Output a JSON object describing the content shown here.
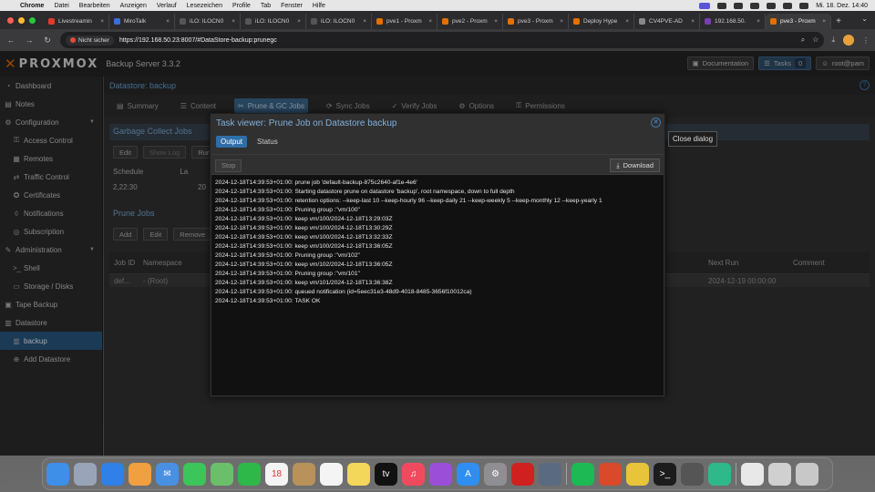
{
  "menubar": {
    "app": "Chrome",
    "items": [
      "Datei",
      "Bearbeiten",
      "Anzeigen",
      "Verlauf",
      "Lesezeichen",
      "Profile",
      "Tab",
      "Fenster",
      "Hilfe"
    ],
    "clock": "Mi. 18. Dez.  14:40"
  },
  "browser": {
    "tabs": [
      {
        "label": "Livestreamin",
        "color": "#e03b2b"
      },
      {
        "label": "MiroTalk",
        "color": "#3a6ee0"
      },
      {
        "label": "iLO: ILOCN0",
        "color": "#555555"
      },
      {
        "label": "iLO: ILOCN0",
        "color": "#555555"
      },
      {
        "label": "iLO: ILOCN0",
        "color": "#555555"
      },
      {
        "label": "pve1 - Proxm",
        "color": "#e57000"
      },
      {
        "label": "pve2 - Proxm",
        "color": "#e57000"
      },
      {
        "label": "pve3 - Proxm",
        "color": "#e57000"
      },
      {
        "label": "Deploy Hype",
        "color": "#e57000"
      },
      {
        "label": "CV4PVE-AD",
        "color": "#888888"
      },
      {
        "label": "192.168.50.",
        "color": "#7a3fb0"
      },
      {
        "label": "pve3 - Proxm",
        "color": "#e57000"
      }
    ],
    "insecure_label": "Nicht sicher",
    "url": "https://192.168.50.23:8007/#DataStore-backup:prunegc"
  },
  "header": {
    "logo": "PROXMOX",
    "product": "Backup Server 3.3.2",
    "documentation": "Documentation",
    "tasks": "Tasks",
    "tasks_count": "0",
    "user": "root@pam"
  },
  "sidebar": {
    "items": [
      {
        "label": "Dashboard",
        "icon": "dashboard-icon",
        "glyph": "◔",
        "level": 0
      },
      {
        "label": "Notes",
        "icon": "notes-icon",
        "glyph": "▤",
        "level": 0
      },
      {
        "label": "Configuration",
        "icon": "gear-icon",
        "glyph": "⚙",
        "level": 0,
        "expanded": true
      },
      {
        "label": "Access Control",
        "icon": "key-icon",
        "glyph": "⚿",
        "level": 1
      },
      {
        "label": "Remotes",
        "icon": "server-icon",
        "glyph": "▦",
        "level": 1
      },
      {
        "label": "Traffic Control",
        "icon": "traffic-icon",
        "glyph": "⇄",
        "level": 1
      },
      {
        "label": "Certificates",
        "icon": "certificate-icon",
        "glyph": "✪",
        "level": 1
      },
      {
        "label": "Notifications",
        "icon": "bell-icon",
        "glyph": "◊",
        "level": 1
      },
      {
        "label": "Subscription",
        "icon": "support-icon",
        "glyph": "◎",
        "level": 1
      },
      {
        "label": "Administration",
        "icon": "wrench-icon",
        "glyph": "✎",
        "level": 0,
        "expanded": true
      },
      {
        "label": "Shell",
        "icon": "terminal-icon",
        "glyph": ">_",
        "level": 1
      },
      {
        "label": "Storage / Disks",
        "icon": "disk-icon",
        "glyph": "▭",
        "level": 1
      },
      {
        "label": "Tape Backup",
        "icon": "tape-icon",
        "glyph": "▣",
        "level": 0
      },
      {
        "label": "Datastore",
        "icon": "database-icon",
        "glyph": "▥",
        "level": 0
      },
      {
        "label": "backup",
        "icon": "datastore-icon",
        "glyph": "▥",
        "level": 1,
        "selected": true
      },
      {
        "label": "Add Datastore",
        "icon": "plus-circle-icon",
        "glyph": "⊕",
        "level": 1
      }
    ]
  },
  "main": {
    "breadcrumb": "Datastore: backup",
    "tabs": [
      {
        "label": "Summary",
        "glyph": "▤"
      },
      {
        "label": "Content",
        "glyph": "☰"
      },
      {
        "label": "Prune & GC Jobs",
        "glyph": "✂",
        "active": true
      },
      {
        "label": "Sync Jobs",
        "glyph": "⟳"
      },
      {
        "label": "Verify Jobs",
        "glyph": "✓"
      },
      {
        "label": "Options",
        "glyph": "⚙"
      },
      {
        "label": "Permissions",
        "glyph": "⚿"
      }
    ],
    "gc": {
      "title": "Garbage Collect Jobs",
      "edit": "Edit",
      "show_log": "Show Log",
      "run": "Run",
      "col_schedule": "Schedule",
      "col_last": "La",
      "schedule_value": "2,22:30",
      "last_value": "20"
    },
    "prune": {
      "title": "Prune Jobs",
      "add": "Add",
      "edit": "Edit",
      "remove": "Remove",
      "col_job_id": "Job ID",
      "col_namespace": "Namespace",
      "col_next_run": "Next Run",
      "col_comment": "Comment",
      "row_job_id": "def...",
      "row_namespace": "- (Root)",
      "row_next_run": "2024-12-19 00:00:00"
    }
  },
  "dialog": {
    "title": "Task viewer: Prune Job on Datastore backup",
    "tab_output": "Output",
    "tab_status": "Status",
    "stop": "Stop",
    "download": "Download",
    "close_tooltip": "Close dialog",
    "log": [
      "2024-12-18T14:39:53+01:00: prune job 'default-backup-875c2640-af1e-4e6'",
      "2024-12-18T14:39:53+01:00: Starting datastore prune on datastore 'backup', root namespace, down to full depth",
      "2024-12-18T14:39:53+01:00: retention options: --keep-last 10 --keep-hourly 96 --keep-daily 21 --keep-weekly 5 --keep-monthly 12 --keep-yearly 1",
      "2024-12-18T14:39:53+01:00: Pruning group :\"vm/100\"",
      "2024-12-18T14:39:53+01:00: keep vm/100/2024-12-18T13:29:03Z",
      "2024-12-18T14:39:53+01:00: keep vm/100/2024-12-18T13:30:29Z",
      "2024-12-18T14:39:53+01:00: keep vm/100/2024-12-18T13:32:33Z",
      "2024-12-18T14:39:53+01:00: keep vm/100/2024-12-18T13:36:05Z",
      "2024-12-18T14:39:53+01:00: Pruning group :\"vm/102\"",
      "2024-12-18T14:39:53+01:00: keep vm/102/2024-12-18T13:36:05Z",
      "2024-12-18T14:39:53+01:00: Pruning group :\"vm/101\"",
      "2024-12-18T14:39:53+01:00: keep vm/101/2024-12-18T13:36:38Z",
      "2024-12-18T14:39:53+01:00: queued notification (id=5eec31e3-48d9-4018-8485-3656f10012ca)",
      "2024-12-18T14:39:53+01:00: TASK OK"
    ]
  },
  "dock": {
    "apps": [
      {
        "name": "finder-icon",
        "color": "#3d8fe8",
        "glyph": ""
      },
      {
        "name": "launchpad-icon",
        "color": "#9aa4b8",
        "glyph": ""
      },
      {
        "name": "safari-icon",
        "color": "#2f80e8",
        "glyph": ""
      },
      {
        "name": "photos-icon",
        "color": "#f0a040",
        "glyph": ""
      },
      {
        "name": "mail-icon",
        "color": "#4a90e2",
        "glyph": "✉"
      },
      {
        "name": "messages-icon",
        "color": "#3cc55a",
        "glyph": ""
      },
      {
        "name": "maps-icon",
        "color": "#6bbf6a",
        "glyph": ""
      },
      {
        "name": "facetime-icon",
        "color": "#2fb84a",
        "glyph": ""
      },
      {
        "name": "calendar-icon",
        "color": "#f4f4f4",
        "glyph": "18"
      },
      {
        "name": "contacts-icon",
        "color": "#b9915a",
        "glyph": ""
      },
      {
        "name": "reminders-icon",
        "color": "#f4f4f4",
        "glyph": ""
      },
      {
        "name": "notes-app-icon",
        "color": "#f3d75a",
        "glyph": ""
      },
      {
        "name": "appletv-icon",
        "color": "#111111",
        "glyph": "tv"
      },
      {
        "name": "music-icon",
        "color": "#f04a5e",
        "glyph": "♫"
      },
      {
        "name": "podcasts-icon",
        "color": "#9b4fd8",
        "glyph": ""
      },
      {
        "name": "appstore-icon",
        "color": "#2f8ef0",
        "glyph": "A"
      },
      {
        "name": "settings-icon",
        "color": "#8e8e93",
        "glyph": "⚙"
      },
      {
        "name": "antivirus-icon",
        "color": "#d02020",
        "glyph": ""
      },
      {
        "name": "quicktime-icon",
        "color": "#5a6a80",
        "glyph": ""
      },
      {
        "name": "spotify-icon",
        "color": "#1db954",
        "glyph": ""
      },
      {
        "name": "xmind-icon",
        "color": "#d84a2a",
        "glyph": ""
      },
      {
        "name": "chrome-icon",
        "color": "#e8c43a",
        "glyph": ""
      },
      {
        "name": "terminal-icon",
        "color": "#1c1c1c",
        "glyph": ">_"
      },
      {
        "name": "calculator-icon",
        "color": "#555555",
        "glyph": ""
      },
      {
        "name": "sync-icon",
        "color": "#2fb88a",
        "glyph": ""
      },
      {
        "name": "document-icon",
        "color": "#e8e8e8",
        "glyph": ""
      },
      {
        "name": "preview-icon",
        "color": "#d0d0d0",
        "glyph": ""
      },
      {
        "name": "trash-icon",
        "color": "#c8c8c8",
        "glyph": ""
      }
    ]
  }
}
